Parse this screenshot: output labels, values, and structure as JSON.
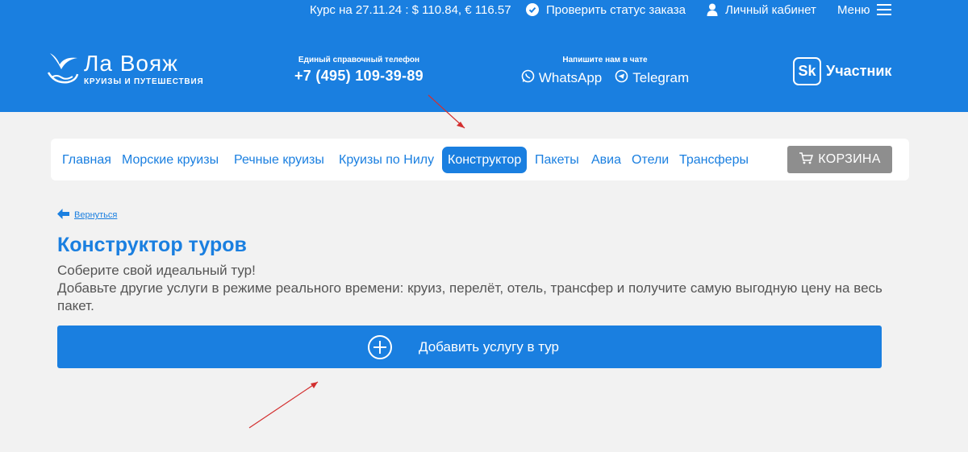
{
  "topbar": {
    "rate": "Курс на 27.11.24 : $ 110.84, € 116.57",
    "status_link": "Проверить статус заказа",
    "cabinet_link": "Личный кабинет",
    "menu_label": "Меню"
  },
  "header": {
    "logo_name": "Ла Вояж",
    "logo_sub": "КРУИЗЫ И ПУТЕШЕСТВИЯ",
    "phone_caption": "Единый справочный телефон",
    "phone": "+7 (495) 109-39-89",
    "chat_caption": "Напишите нам в чате",
    "whatsapp": "WhatsApp",
    "telegram": "Telegram",
    "sk_logo": "Sk",
    "sk_label": "Участник"
  },
  "nav": {
    "items": [
      {
        "label": "Главная"
      },
      {
        "label": "Морские круизы"
      },
      {
        "label": "Речные круизы"
      },
      {
        "label": "Круизы по Нилу"
      },
      {
        "label": "Конструктор",
        "active": true
      },
      {
        "label": "Пакеты"
      },
      {
        "label": "Авиа"
      },
      {
        "label": "Отели"
      },
      {
        "label": "Трансферы"
      }
    ],
    "cart_label": "КОРЗИНА"
  },
  "main": {
    "back_label": "Вернуться",
    "title": "Конструктор туров",
    "desc_line1": "Соберите свой идеальный тур!",
    "desc_line2": "Добавьте другие услуги в режиме реального времени: круиз, перелёт, отель, трансфер и получите самую выгодную цену на весь пакет.",
    "add_button": "Добавить услугу в тур"
  },
  "icons": {
    "status": "check-circle-icon",
    "cabinet": "user-icon",
    "menu": "hamburger-icon",
    "logo": "seagull-icon",
    "whatsapp": "whatsapp-icon",
    "telegram": "telegram-icon",
    "cart": "cart-icon",
    "back": "arrow-left-icon",
    "add": "plus-circle-icon"
  },
  "colors": {
    "brand_blue": "#1a7fe0",
    "background": "#f2f2f2",
    "cart_grey": "#8e8e8e",
    "annotation_red": "#d32f2f"
  }
}
